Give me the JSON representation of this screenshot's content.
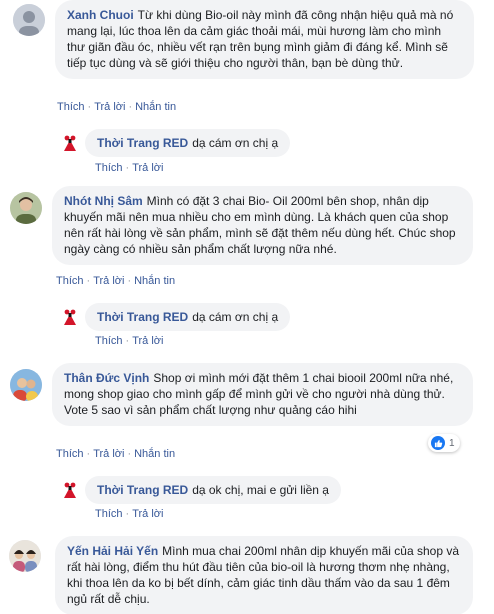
{
  "comments": [
    {
      "author": "Xanh Chuoi",
      "text": "Từ khi dùng Bio-oil này mình đã công nhận hiệu quả mà nó mang lại, lúc thoa lên da cảm giác thoải mái, mùi hương làm cho mình thư giãn đầu óc, nhiều vết rạn trên bụng mình giảm đi đáng kể. Mình sẽ tiếp tục dùng và sẽ giới thiệu cho người thân, bạn bè dùng thử.",
      "actions": [
        "Thích",
        "Trả lời",
        "Nhắn tin"
      ],
      "reply": {
        "author": "Thời Trang RED",
        "text": "dạ cám ơn chị ạ",
        "actions": [
          "Thích",
          "Trả lời"
        ]
      }
    },
    {
      "author": "Nhót Nhị Sâm",
      "text": "Mình có đặt 3 chai Bio- Oil 200ml bên shop, nhân dịp khuyến mãi nên mua nhiều cho em mình dùng. Là khách quen của shop nên rất hài lòng về sản phẩm, mình sẽ đặt thêm nếu dùng hết. Chúc shop ngày càng có nhiều sản phẩm chất lượng nữa nhé.",
      "actions": [
        "Thích",
        "Trả lời",
        "Nhắn tin"
      ],
      "reply": {
        "author": "Thời Trang RED",
        "text": "dạ cám ơn chị ạ",
        "actions": [
          "Thích",
          "Trả lời"
        ]
      }
    },
    {
      "author": "Thân Đức Vịnh",
      "text": "Shop ơi mình mới đặt thêm 1 chai biooil 200ml nữa nhé, mong shop giao cho mình gấp để mình gửi về cho người nhà dùng thử. Vote 5 sao vì sản phẩm chất lượng như quảng cáo hihi",
      "reaction_count": "1",
      "actions": [
        "Thích",
        "Trả lời",
        "Nhắn tin"
      ],
      "reply": {
        "author": "Thời Trang RED",
        "text": "dạ ok chị, mai e gửi liền ạ",
        "actions": [
          "Thích",
          "Trả lời"
        ]
      }
    },
    {
      "author": "Yến Hải Hải Yến",
      "text": "Mình mua chai 200ml nhân dịp khuyến mãi của shop và rất hài lòng, điểm thu hút đầu tiên của bio-oil là hương thơm nhẹ nhàng, khi thoa lên da ko bị bết dính, cảm giác tinh dầu thấm vào da sau 1 đêm ngủ rất dễ chịu."
    }
  ],
  "colors": {
    "link": "#385898",
    "bubble": "#f2f3f5",
    "meta": "#616770",
    "like": "#1877f2"
  }
}
